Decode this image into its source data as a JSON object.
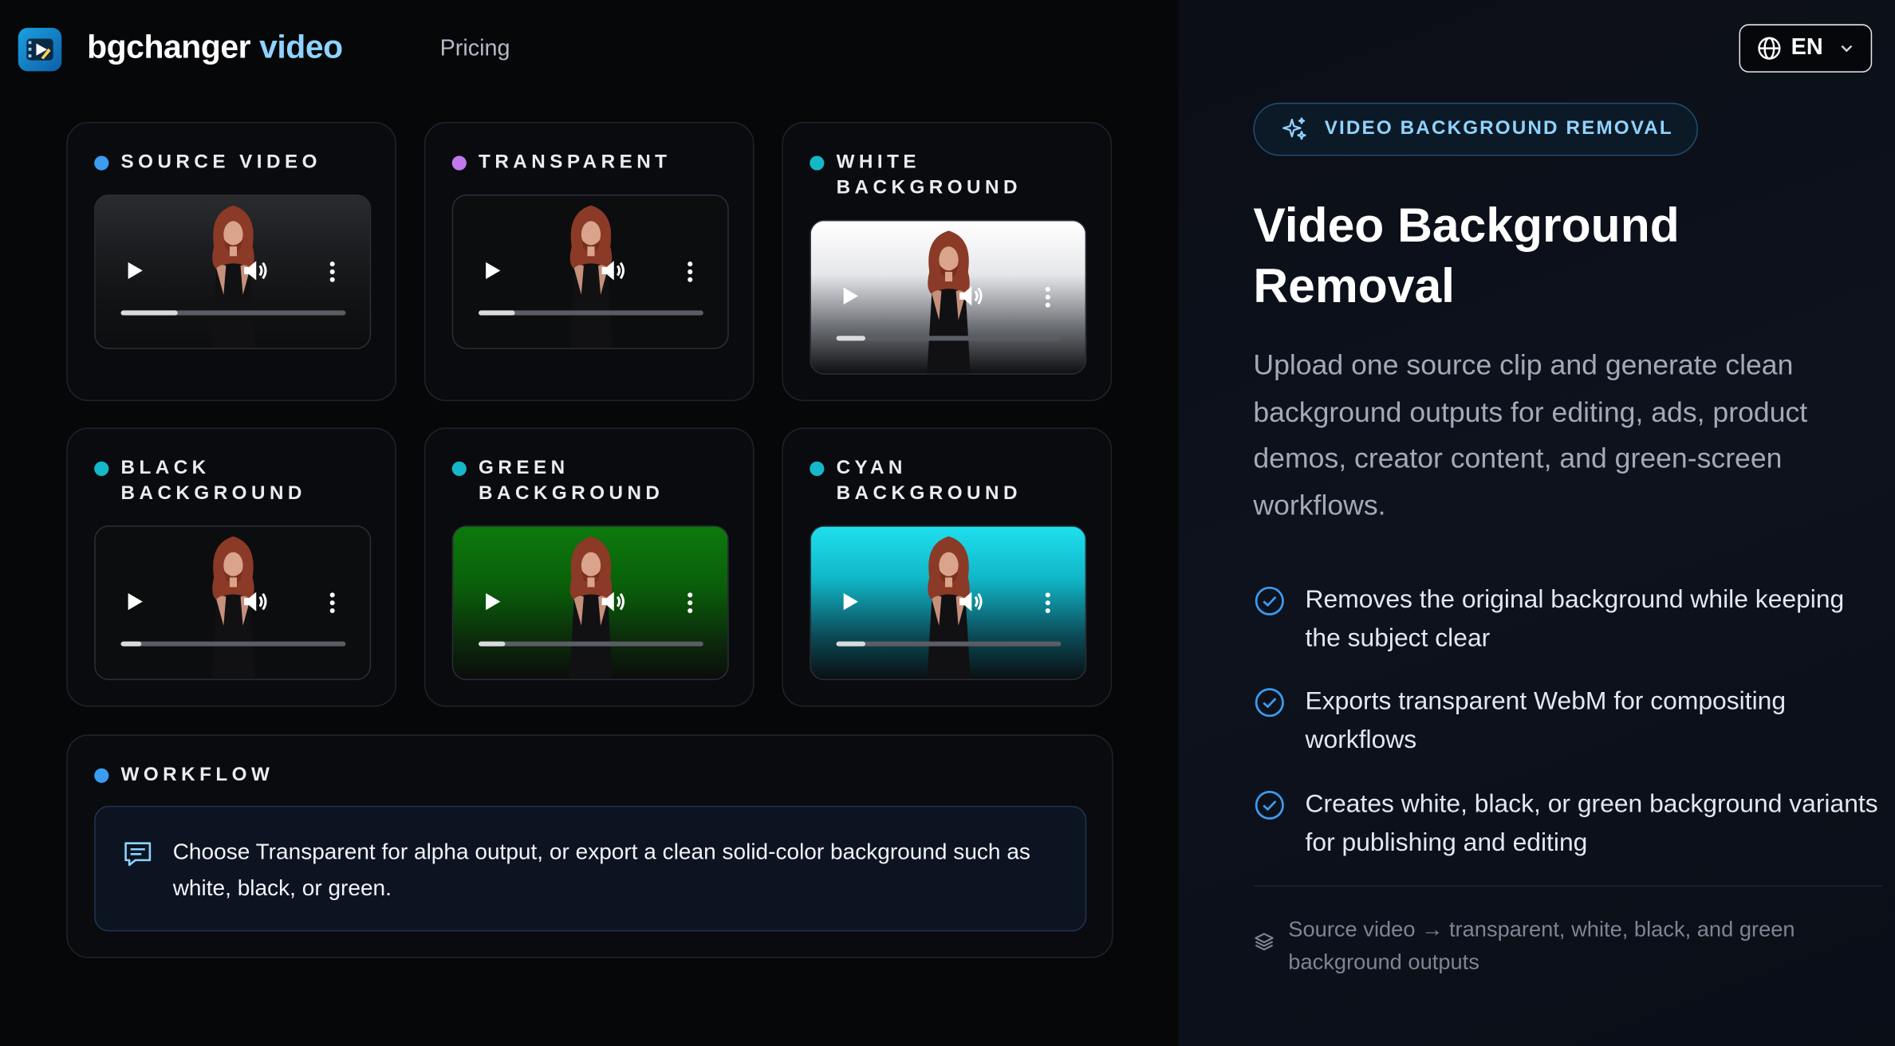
{
  "header": {
    "brand_part1": "bgchanger",
    "brand_part2": "video",
    "nav_pricing": "Pricing",
    "lang": "EN"
  },
  "cards": [
    {
      "title": "SOURCE VIDEO",
      "dot_color": "#3b9cf0",
      "bg": "bg-source",
      "progress": 0.25
    },
    {
      "title": "TRANSPARENT",
      "dot_color": "#c178ef",
      "bg": "bg-transparent",
      "progress": 0.16
    },
    {
      "title": "WHITE BACKGROUND",
      "dot_color": "#15b8c8",
      "bg": "bg-white",
      "progress": 0.13
    },
    {
      "title": "BLACK BACKGROUND",
      "dot_color": "#15b8c8",
      "bg": "bg-black",
      "progress": 0.09
    },
    {
      "title": "GREEN BACKGROUND",
      "dot_color": "#15b8c8",
      "bg": "bg-green",
      "progress": 0.12
    },
    {
      "title": "CYAN BACKGROUND",
      "dot_color": "#15b8c8",
      "bg": "bg-cyan",
      "progress": 0.13
    }
  ],
  "workflow": {
    "title": "WORKFLOW",
    "dot_color": "#3b9cf0",
    "text": "Choose Transparent for alpha output, or export a clean solid-color background such as white, black, or green."
  },
  "hero": {
    "badge": "VIDEO BACKGROUND REMOVAL",
    "title": "Video Background Removal",
    "description": "Upload one source clip and generate clean background outputs for editing, ads, product demos, creator content, and green-screen workflows.",
    "features": [
      "Removes the original background while keeping the subject clear",
      "Exports transparent WebM for compositing workflows",
      "Creates white, black, or green background variants for publishing and editing"
    ],
    "footer_note": "Source video → transparent, white, black, and green background outputs"
  },
  "colors": {
    "accent": "#8fd3ff",
    "check": "#3b9cf0",
    "page_bg": "#05060a"
  }
}
